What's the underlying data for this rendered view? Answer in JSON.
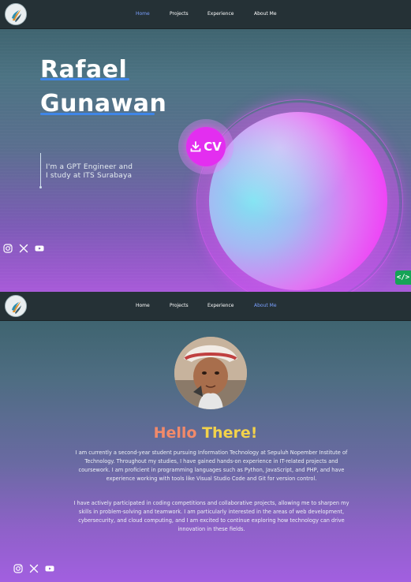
{
  "nav": {
    "items": [
      {
        "label": "Home"
      },
      {
        "label": "Projects"
      },
      {
        "label": "Experience"
      },
      {
        "label": "About Me"
      }
    ]
  },
  "hero": {
    "name_first": "Rafael",
    "name_last": "Gunawan",
    "intro_line1": "I'm a GPT Engineer and",
    "intro_line2": "I study at ITS Surabaya",
    "cv_label": "CV",
    "code_label": "</>"
  },
  "about": {
    "hello_word1": "Hello",
    "hello_word2": "There!",
    "paragraph1": "I am currently a second-year student pursuing Information Technology at Sepuluh Nopember Institute of Technology. Throughout my studies, I have gained hands-on experience in IT-related projects and coursework. I am proficient in programming languages such as Python, JavaScript, and PHP, and have experience working with tools like Visual Studio Code and Git for version control.",
    "paragraph2": "I have actively participated in coding competitions and collaborative projects, allowing me to sharpen my skills in problem-solving and teamwork. I am particularly interested in the areas of web development, cybersecurity, and cloud computing, and I am excited to continue exploring how technology can drive innovation in these fields."
  },
  "social": [
    "instagram-icon",
    "x-icon",
    "youtube-icon"
  ],
  "colors": {
    "accent_blue": "#3f86e8",
    "cv_magenta": "#e32ef0",
    "hello_orange": "#f28a6a",
    "hello_yellow": "#f3d24a",
    "code_green": "#15a356"
  }
}
